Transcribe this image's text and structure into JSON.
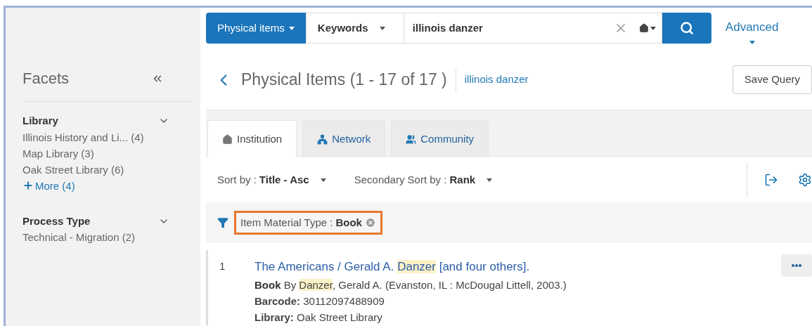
{
  "sidebar": {
    "title": "Facets",
    "groups": [
      {
        "title": "Library",
        "expanded": true,
        "items": [
          "Illinois History and Li... (4)",
          "Map Library (3)",
          "Oak Street Library (6)"
        ],
        "more": "More (4)"
      },
      {
        "title": "Process Type",
        "expanded": true,
        "items": [
          "Technical - Migration (2)"
        ]
      }
    ]
  },
  "search": {
    "scope": "Physical items",
    "field": "Keywords",
    "value": "illinois danzer",
    "advanced": "Advanced"
  },
  "header": {
    "title": "Physical Items (1 - 17 of 17 )",
    "query": "illinois danzer",
    "save": "Save Query"
  },
  "tabs": [
    {
      "label": "Institution",
      "selected": true
    },
    {
      "label": "Network",
      "selected": false
    },
    {
      "label": "Community",
      "selected": false
    }
  ],
  "sort": [
    {
      "label": "Sort by :",
      "value": "Title - Asc"
    },
    {
      "label": "Secondary Sort by :",
      "value": "Rank"
    }
  ],
  "filter": {
    "label": "Item Material Type :",
    "value": "Book",
    "highlighted": true
  },
  "results": [
    {
      "number": "1",
      "title": [
        {
          "text": "The Americans / Gerald A. ",
          "highlight": false
        },
        {
          "text": "Danzer",
          "highlight": true
        },
        {
          "text": " [and four others].",
          "highlight": false
        }
      ],
      "byline": [
        {
          "text": "Book",
          "bold": true,
          "highlight": false
        },
        {
          "text": " By ",
          "bold": false,
          "highlight": false
        },
        {
          "text": "Danzer",
          "bold": false,
          "highlight": true
        },
        {
          "text": ", Gerald A. (Evanston, IL : McDougal Littell, 2003.)",
          "bold": false,
          "highlight": false
        }
      ],
      "barcode": "**Barcode:** 30112097488909",
      "library": "**Library:** Oak Street Library"
    }
  ]
}
